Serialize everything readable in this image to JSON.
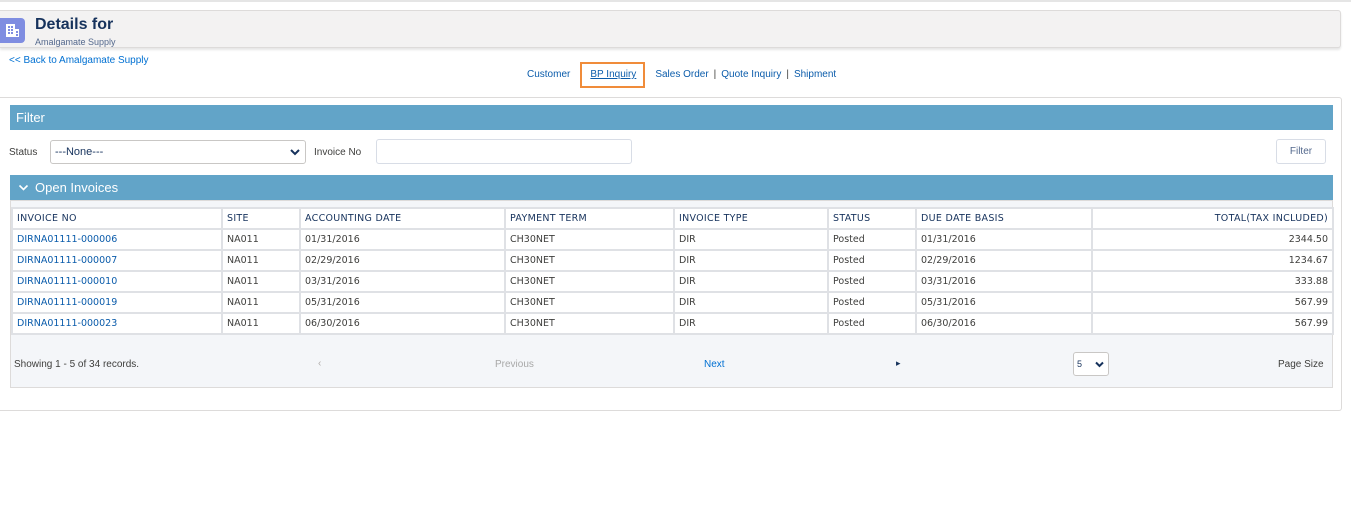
{
  "header": {
    "title": "Details for",
    "subtitle": "Amalgamate Supply",
    "icon": "building-icon"
  },
  "back_link": "<< Back to Amalgamate Supply",
  "nav": {
    "customer": "Customer",
    "bp_inquiry": "BP Inquiry",
    "sales_order": "Sales Order",
    "quote_inquiry": "Quote Inquiry",
    "shipment": "Shipment",
    "separator": "|",
    "highlight_color": "#f08c3a"
  },
  "filter": {
    "heading": "Filter",
    "status_label": "Status",
    "status_value": "---None---",
    "invoice_label": "Invoice No",
    "invoice_value": "",
    "button": "Filter"
  },
  "invoices": {
    "heading": "Open Invoices",
    "columns": [
      "INVOICE NO",
      "SITE",
      "ACCOUNTING DATE",
      "PAYMENT TERM",
      "INVOICE TYPE",
      "STATUS",
      "DUE DATE BASIS",
      "TOTAL(TAX INCLUDED)"
    ],
    "rows": [
      [
        "DIRNA01111-000006",
        "NA011",
        "01/31/2016",
        "CH30NET",
        "DIR",
        "Posted",
        "01/31/2016",
        "2344.50"
      ],
      [
        "DIRNA01111-000007",
        "NA011",
        "02/29/2016",
        "CH30NET",
        "DIR",
        "Posted",
        "02/29/2016",
        "1234.67"
      ],
      [
        "DIRNA01111-000010",
        "NA011",
        "03/31/2016",
        "CH30NET",
        "DIR",
        "Posted",
        "03/31/2016",
        "333.88"
      ],
      [
        "DIRNA01111-000019",
        "NA011",
        "05/31/2016",
        "CH30NET",
        "DIR",
        "Posted",
        "05/31/2016",
        "567.99"
      ],
      [
        "DIRNA01111-000023",
        "NA011",
        "06/30/2016",
        "CH30NET",
        "DIR",
        "Posted",
        "06/30/2016",
        "567.99"
      ]
    ]
  },
  "pagination": {
    "showing": "Showing 1 - 5 of 34 records.",
    "prev_arrow": "‹",
    "previous": "Previous",
    "next": "Next",
    "next_arrow": "▸",
    "page_size_value": "5",
    "page_size_label": "Page Size"
  },
  "colors": {
    "section_bar": "#62a4c8",
    "link": "#0b5cab"
  }
}
